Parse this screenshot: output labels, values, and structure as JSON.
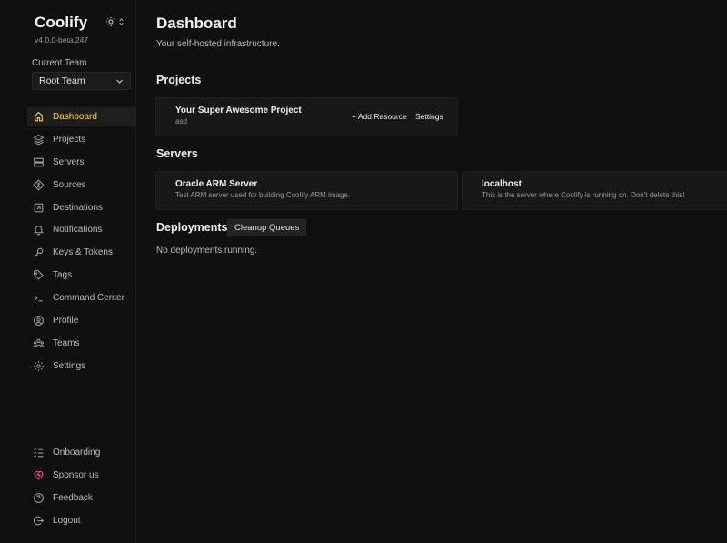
{
  "brand": {
    "name": "Coolify",
    "version": "v4.0.0-beta.247"
  },
  "team": {
    "label": "Current Team",
    "selected": "Root Team"
  },
  "nav": {
    "items": [
      {
        "label": "Dashboard",
        "icon": "home-icon"
      },
      {
        "label": "Projects",
        "icon": "layers-icon"
      },
      {
        "label": "Servers",
        "icon": "server-icon"
      },
      {
        "label": "Sources",
        "icon": "git-icon"
      },
      {
        "label": "Destinations",
        "icon": "destination-icon"
      },
      {
        "label": "Notifications",
        "icon": "bell-icon"
      },
      {
        "label": "Keys & Tokens",
        "icon": "key-icon"
      },
      {
        "label": "Tags",
        "icon": "tag-icon"
      },
      {
        "label": "Command Center",
        "icon": "terminal-icon"
      },
      {
        "label": "Profile",
        "icon": "user-circle-icon"
      },
      {
        "label": "Teams",
        "icon": "users-icon"
      },
      {
        "label": "Settings",
        "icon": "gear-icon"
      }
    ],
    "bottom": [
      {
        "label": "Onboarding",
        "icon": "checklist-icon"
      },
      {
        "label": "Sponsor us",
        "icon": "heart-icon"
      },
      {
        "label": "Feedback",
        "icon": "help-icon"
      },
      {
        "label": "Logout",
        "icon": "logout-icon"
      }
    ]
  },
  "main": {
    "title": "Dashboard",
    "subtitle": "Your self-hosted infrastructure.",
    "projects": {
      "heading": "Projects",
      "items": [
        {
          "name": "Your Super Awesome Project",
          "description": "asd",
          "add_resource": "+ Add Resource",
          "settings": "Settings"
        }
      ]
    },
    "servers": {
      "heading": "Servers",
      "items": [
        {
          "name": "Oracle ARM Server",
          "description": "Test ARM server used for building Coolify ARM image."
        },
        {
          "name": "localhost",
          "description": "This is the server where Coolify is running on. Don't delete this!"
        }
      ]
    },
    "deployments": {
      "heading": "Deployments",
      "cleanup_label": "Cleanup Queues",
      "empty": "No deployments running."
    }
  },
  "colors": {
    "background": "#101010",
    "card": "#181818",
    "accent": "#fcd452",
    "sponsor": "#e94f8f"
  }
}
